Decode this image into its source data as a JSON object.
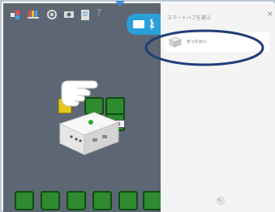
{
  "panel": {
    "title": "スマートハブを選ぶ",
    "close_glyph": "×",
    "hubs": [
      {
        "label": "ぜったかい"
      }
    ]
  },
  "toolbar": {
    "icons": [
      "blocks-menu-icon",
      "paint-icon",
      "settings-icon",
      "camera-icon",
      "document-icon",
      "help-icon"
    ],
    "help_glyph": "?"
  },
  "workspace": {
    "input_value": "1"
  },
  "palette": {
    "icons": [
      "motor-forward-block-icon",
      "motor-backward-block-icon",
      "motor-stop-block-icon",
      "motor-power-block-icon",
      "tilt-sensor-block-icon",
      "distance-sensor-block-icon"
    ]
  },
  "colors": {
    "workspace_bg": "#5d6773",
    "block_green": "#2f8a30",
    "hub_button_blue": "#2aa0d8",
    "annotation_circle": "#223d78",
    "panel_bg": "#f4f4f4"
  }
}
